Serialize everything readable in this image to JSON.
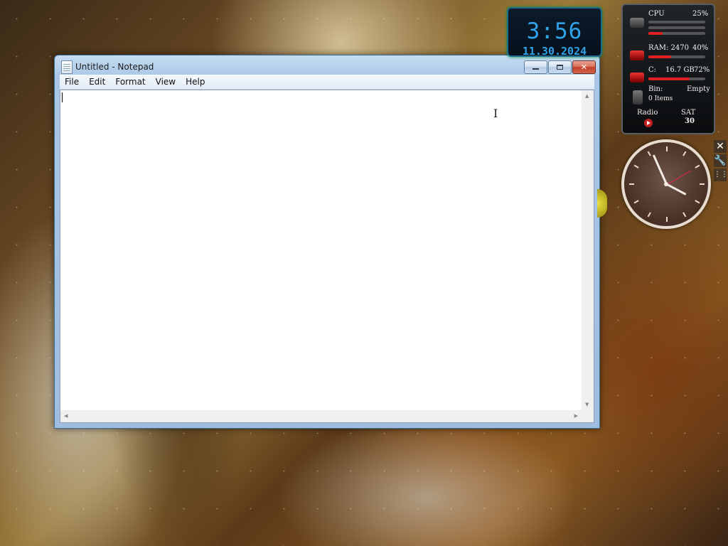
{
  "notepad": {
    "title": "Untitled - Notepad",
    "menu": [
      "File",
      "Edit",
      "Format",
      "View",
      "Help"
    ],
    "content": ""
  },
  "clock_gadget": {
    "time": "3:56",
    "date": "11.30.2024"
  },
  "meter_gadget": {
    "cpu_label": "CPU",
    "cpu_value": "25%",
    "cpu_fraction": 0.25,
    "ram_label": "RAM: 2470",
    "ram_value": "40%",
    "ram_fraction": 0.4,
    "drive_label": "C:",
    "drive_size": "16.7 GB",
    "drive_value": "72%",
    "drive_fraction": 0.72,
    "bin_label": "Bin:",
    "bin_status": "Empty",
    "bin_items": "0 Items",
    "radio_label": "Radio",
    "day": "SAT",
    "day_number": "30"
  },
  "analog_clock": {
    "hours": 3,
    "minutes": 56,
    "seconds": 10
  },
  "colors": {
    "clock_digits": "#2fa2e8",
    "meter_fill": "#e02020"
  },
  "icons": {
    "close": "close-icon",
    "wrench": "wrench-icon",
    "grip": "drag-grip-icon"
  }
}
